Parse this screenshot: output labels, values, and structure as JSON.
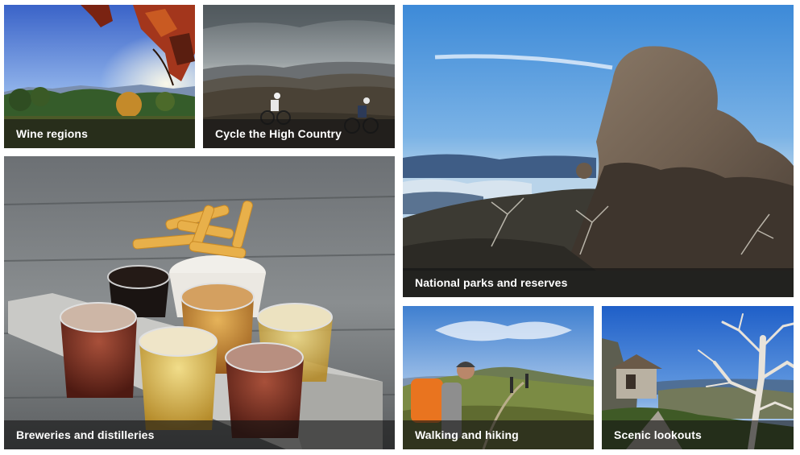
{
  "tiles": [
    {
      "id": "wine",
      "label": "Wine regions"
    },
    {
      "id": "cycle",
      "label": "Cycle the High Country"
    },
    {
      "id": "parks",
      "label": "National parks and reserves"
    },
    {
      "id": "brew",
      "label": "Breweries and distilleries"
    },
    {
      "id": "walk",
      "label": "Walking and hiking"
    },
    {
      "id": "scenic",
      "label": "Scenic lookouts"
    }
  ],
  "colors": {
    "caption_overlay": "#141414",
    "caption_text": "#ffffff",
    "sky_blue": "#4f86d6",
    "foliage_red": "#a3361c"
  }
}
